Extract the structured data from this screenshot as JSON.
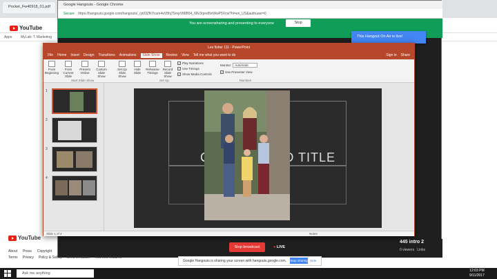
{
  "background": {
    "tabs": [
      "Pocket_Fw40918_01.pdf",
      "Google Hangouts - Google Chrome"
    ],
    "bookmarks": [
      "Apps",
      "MyLab: T. Marketing"
    ],
    "youtube_logo": "YouTube",
    "footer_links": [
      "About",
      "Press",
      "Copyright",
      "Terms",
      "Privacy",
      "Policy & Safety",
      "Send feedback",
      "Test new features"
    ]
  },
  "hangouts": {
    "window_title": "Google Hangouts - Google Chrome",
    "url_secure": "Secure",
    "url": "https://hangouts.google.com/hangouts/_/ytl/3ZfkYcum4vV8hj7SmpVMlB54_68v3rpndNnWwP5Vcw?hl=en_US&authuser=0",
    "banner_text": "You are screensharing and presenting to everyone",
    "stop_label": "Stop",
    "on_air_text": "This Hangout On Air is live!",
    "stop_broadcast": "Stop broadcast",
    "live_label": "LIVE",
    "intros_title": "445 intro 2",
    "viewers": "0 viewers",
    "links_label": "Links"
  },
  "powerpoint": {
    "title": "Lee fisher 111 - PowerPoint",
    "sign_in": "Sign in",
    "share": "Share",
    "menu": [
      "File",
      "Home",
      "Insert",
      "Design",
      "Transitions",
      "Animations",
      "Slide Show",
      "Review",
      "View"
    ],
    "tell_me": "Tell me what you want to do",
    "ribbon_buttons": [
      "From Beginning",
      "From Current Slide",
      "Present Online",
      "Custom Slide Show",
      "Set Up Slide Show",
      "Hide Slide",
      "Rehearse Timings",
      "Record Slide Show"
    ],
    "checkboxes": [
      "Play Narrations",
      "Use Timings",
      "Show Media Controls"
    ],
    "monitor_label": "Monitor:",
    "monitor_value": "Automatic",
    "presenter_view": "Use Presenter View",
    "groups": [
      "Start Slide Show",
      "Set Up",
      "Monitors"
    ],
    "slide_numbers": [
      "1",
      "2",
      "3",
      "4"
    ],
    "slide_title": "CLICK TO ADD TITLE",
    "status_slide": "Slide 1 of 4",
    "status_notes": "Notes"
  },
  "share_bar": {
    "text": "Google Hangouts is sharing your screen with hangouts.google.com.",
    "stop_sharing": "Stop sharing",
    "hide": "Hide"
  },
  "taskbar": {
    "search_placeholder": "Ask me anything",
    "time": "12:03 PM",
    "date": "9/11/2017"
  },
  "colors": {
    "ppt_accent": "#b7472a",
    "hangouts_green": "#0f9d58",
    "youtube_red": "#e62117",
    "stop_red": "#e53935"
  }
}
